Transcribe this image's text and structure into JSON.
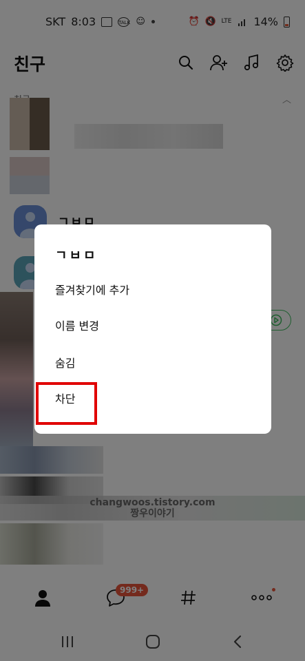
{
  "status_bar": {
    "carrier": "SKT",
    "time": "8:03",
    "network": "LTE",
    "battery": "14%"
  },
  "header": {
    "title": "친구",
    "icons": [
      "search-icon",
      "add-friend-icon",
      "music-icon",
      "settings-icon"
    ]
  },
  "list": {
    "section_label": "친구",
    "friend_name": "ㄱㅂㅁ"
  },
  "dialog": {
    "title": "ㄱㅂㅁ",
    "menu": [
      "즐겨찾기에 추가",
      "이름 변경",
      "숨김",
      "차단"
    ],
    "highlight_color": "#e00000"
  },
  "watermark": {
    "line1": "changwoos.tistory.com",
    "line2": "짱우이야기"
  },
  "bottom_nav": {
    "items": [
      "friends-icon",
      "chat-icon",
      "openchat-icon",
      "more-icon"
    ],
    "chat_badge": "999+"
  },
  "colors": {
    "badge": "#e8543b",
    "accent_green": "#3dbb5e",
    "avatar_blue": "#6a8fd6"
  }
}
